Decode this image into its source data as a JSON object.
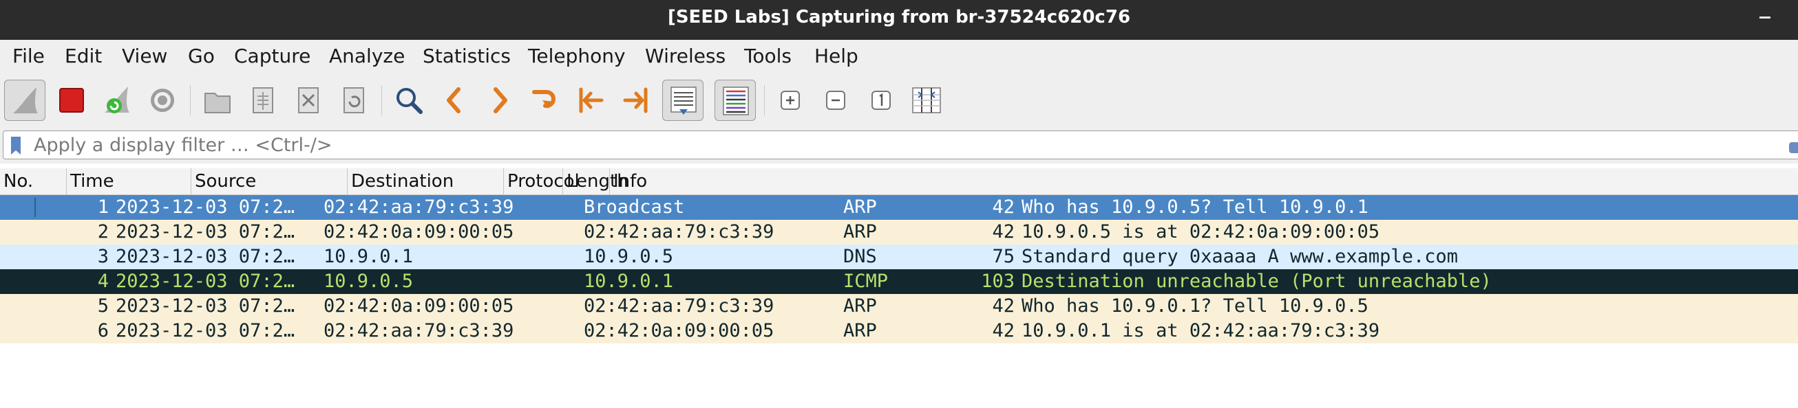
{
  "window": {
    "title": "[SEED Labs] Capturing from br-37524c620c76"
  },
  "menu": [
    {
      "label": "File"
    },
    {
      "label": "Edit"
    },
    {
      "label": "View"
    },
    {
      "label": "Go"
    },
    {
      "label": "Capture"
    },
    {
      "label": "Analyze"
    },
    {
      "label": "Statistics"
    },
    {
      "label": "Telephony"
    },
    {
      "label": "Wireless"
    },
    {
      "label": "Tools"
    },
    {
      "label": "Help"
    }
  ],
  "toolbar": {
    "icons": [
      "shark-fin-start-icon",
      "stop-capture-icon",
      "restart-capture-icon",
      "capture-options-gear-icon",
      "open-file-icon",
      "save-file-icon",
      "close-file-icon",
      "reload-file-icon",
      "find-packet-icon",
      "go-back-icon",
      "go-forward-icon",
      "go-to-packet-icon",
      "first-packet-icon",
      "last-packet-icon",
      "auto-scroll-icon",
      "colorize-icon",
      "zoom-in-icon",
      "zoom-out-icon",
      "normal-size-icon",
      "resize-columns-icon"
    ]
  },
  "filter": {
    "placeholder": "Apply a display filter … <Ctrl-/>"
  },
  "packet_list": {
    "columns": [
      "No.",
      "Time",
      "Source",
      "Destination",
      "Protocol",
      "Length",
      "Info"
    ],
    "rows": [
      {
        "no": "1",
        "time": "2023-12-03 07:2…",
        "source": "02:42:aa:79:c3:39",
        "destination": "Broadcast",
        "protocol": "ARP",
        "length": "42",
        "info": "Who has 10.9.0.5? Tell 10.9.0.1",
        "bg": "#4a86c5",
        "fg": "#ffffff"
      },
      {
        "no": "2",
        "time": "2023-12-03 07:2…",
        "source": "02:42:0a:09:00:05",
        "destination": "02:42:aa:79:c3:39",
        "protocol": "ARP",
        "length": "42",
        "info": "10.9.0.5 is at 02:42:0a:09:00:05",
        "bg": "#faf0d7",
        "fg": "#12272e"
      },
      {
        "no": "3",
        "time": "2023-12-03 07:2…",
        "source": "10.9.0.1",
        "destination": "10.9.0.5",
        "protocol": "DNS",
        "length": "75",
        "info": "Standard query 0xaaaa A www.example.com",
        "bg": "#daeeff",
        "fg": "#12272e"
      },
      {
        "no": "4",
        "time": "2023-12-03 07:2…",
        "source": "10.9.0.5",
        "destination": "10.9.0.1",
        "protocol": "ICMP",
        "length": "103",
        "info": "Destination unreachable (Port unreachable)",
        "bg": "#12272e",
        "fg": "#b5e26c"
      },
      {
        "no": "5",
        "time": "2023-12-03 07:2…",
        "source": "02:42:0a:09:00:05",
        "destination": "02:42:aa:79:c3:39",
        "protocol": "ARP",
        "length": "42",
        "info": "Who has 10.9.0.1? Tell 10.9.0.5",
        "bg": "#faf0d7",
        "fg": "#12272e"
      },
      {
        "no": "6",
        "time": "2023-12-03 07:2…",
        "source": "02:42:aa:79:c3:39",
        "destination": "02:42:0a:09:00:05",
        "protocol": "ARP",
        "length": "42",
        "info": "10.9.0.1 is at 02:42:aa:79:c3:39",
        "bg": "#faf0d7",
        "fg": "#12272e"
      }
    ]
  }
}
